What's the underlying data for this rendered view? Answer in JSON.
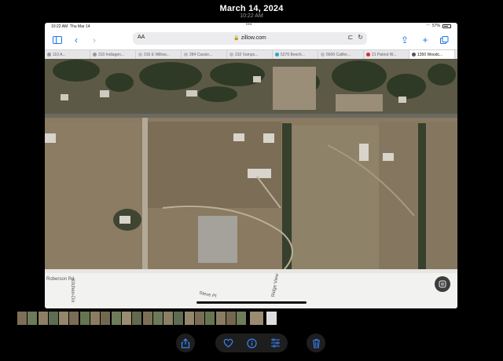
{
  "photos_header": {
    "date": "March 14, 2024",
    "time": "10:22 AM"
  },
  "status_bar": {
    "time": "10:22 AM",
    "date": "Thu Mar 14",
    "battery": "57%"
  },
  "safari": {
    "aa_label": "AA",
    "url": "zillow.com",
    "tabs": [
      {
        "label": "110 A...",
        "favicon_color": "#9a9a9a"
      },
      {
        "label": "310 Indiagen...",
        "favicon_color": "#9a9a9a"
      },
      {
        "label": "316 E Willow...",
        "favicon_color": "#bdbdbd"
      },
      {
        "label": "284 Cassie...",
        "favicon_color": "#bdbdbd"
      },
      {
        "label": "232 Vumps...",
        "favicon_color": "#bdbdbd"
      },
      {
        "label": "5276 Beech...",
        "favicon_color": "#2aa6c7"
      },
      {
        "label": "5606 Califor...",
        "favicon_color": "#bdbdbd"
      },
      {
        "label": "21 Patriot W...",
        "favicon_color": "#d32f2f"
      },
      {
        "label": "1350 Woodc...",
        "favicon_color": "#555555"
      }
    ],
    "active_tab_index": 8
  },
  "map": {
    "road_labels": {
      "roberson": "Roberson Rd",
      "kitchen": "Kitchen-Dix",
      "steve": "Steve Pl",
      "ridge": "Ridge View"
    }
  },
  "photo_strip_count": 24,
  "bottom_toolbar": {
    "share_icon": "share-icon",
    "favorite_icon": "heart-icon",
    "info_icon": "info-icon",
    "adjust_icon": "adjust-icon",
    "delete_icon": "trash-icon"
  },
  "colors": {
    "accent": "#1a73e8",
    "background": "#000000"
  }
}
